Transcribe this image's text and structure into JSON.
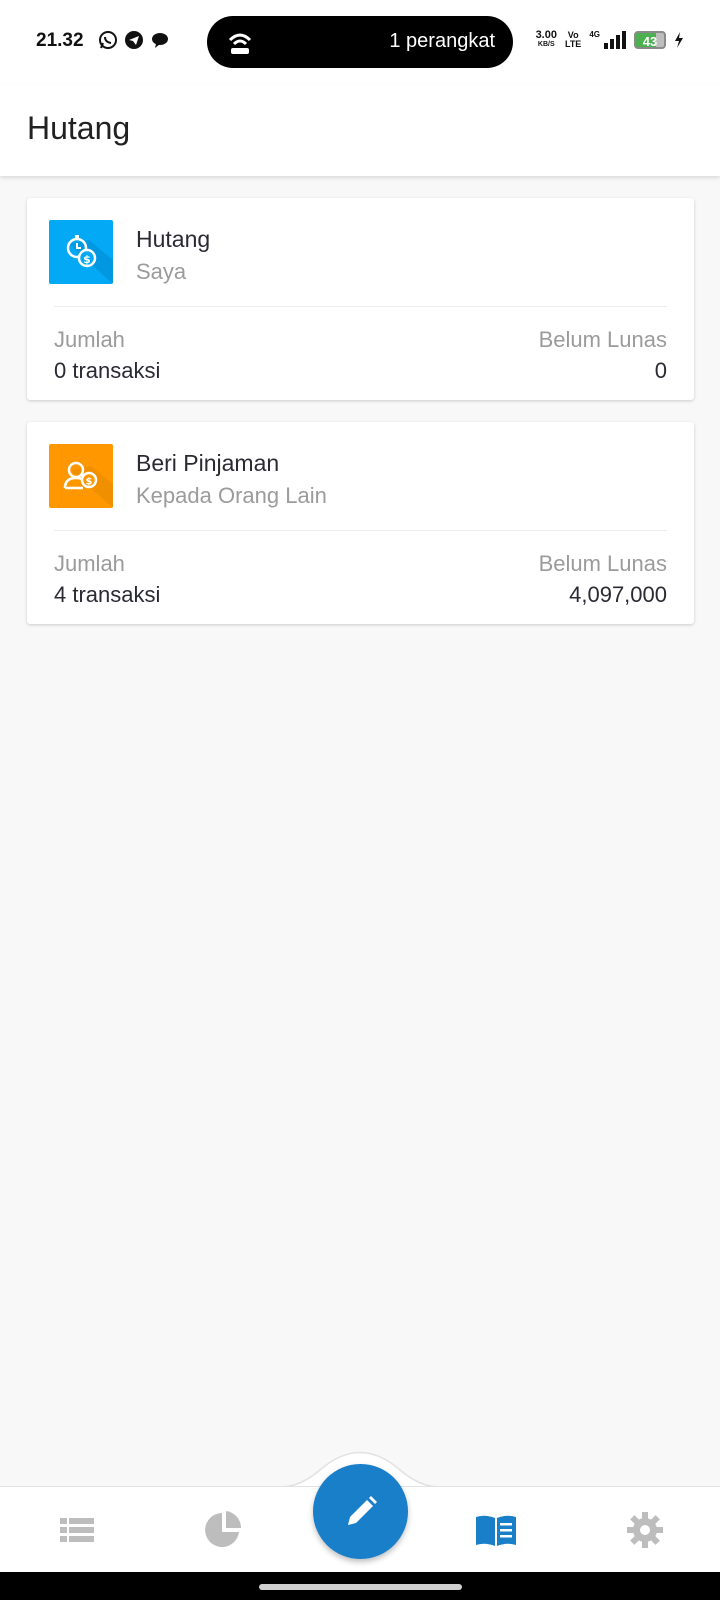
{
  "status_bar": {
    "time": "21.32",
    "notification_icons": [
      "whatsapp-icon",
      "telegram-icon",
      "chat-bubble-icon"
    ],
    "hotspot_text": "1 perangkat",
    "net_speed": "3.00",
    "net_speed_unit": "KB/S",
    "volte_top": "Vo",
    "volte_bottom": "LTE",
    "network_type": "4G",
    "battery_level": "43",
    "battery_color": "#4caf50"
  },
  "appbar": {
    "title": "Hutang"
  },
  "cards": [
    {
      "title": "Hutang",
      "subtitle": "Saya",
      "left_label": "Jumlah",
      "left_value": "0 transaksi",
      "right_label": "Belum Lunas",
      "right_value": "0",
      "icon": "stopwatch-dollar-icon",
      "icon_color": "#03a9f4"
    },
    {
      "title": "Beri Pinjaman",
      "subtitle": "Kepada Orang Lain",
      "left_label": "Jumlah",
      "left_value": "4 transaksi",
      "right_label": "Belum Lunas",
      "right_value": "4,097,000",
      "icon": "person-dollar-icon",
      "icon_color": "#ff9800"
    }
  ],
  "bottom_nav": {
    "items": [
      "list-icon",
      "pie-chart-icon",
      "book-icon",
      "gear-icon"
    ],
    "active": "book-icon",
    "active_color": "#1a7fc9",
    "inactive_color": "#bdbdbd",
    "fab_icon": "pencil-icon",
    "fab_color": "#1a7fc9"
  }
}
